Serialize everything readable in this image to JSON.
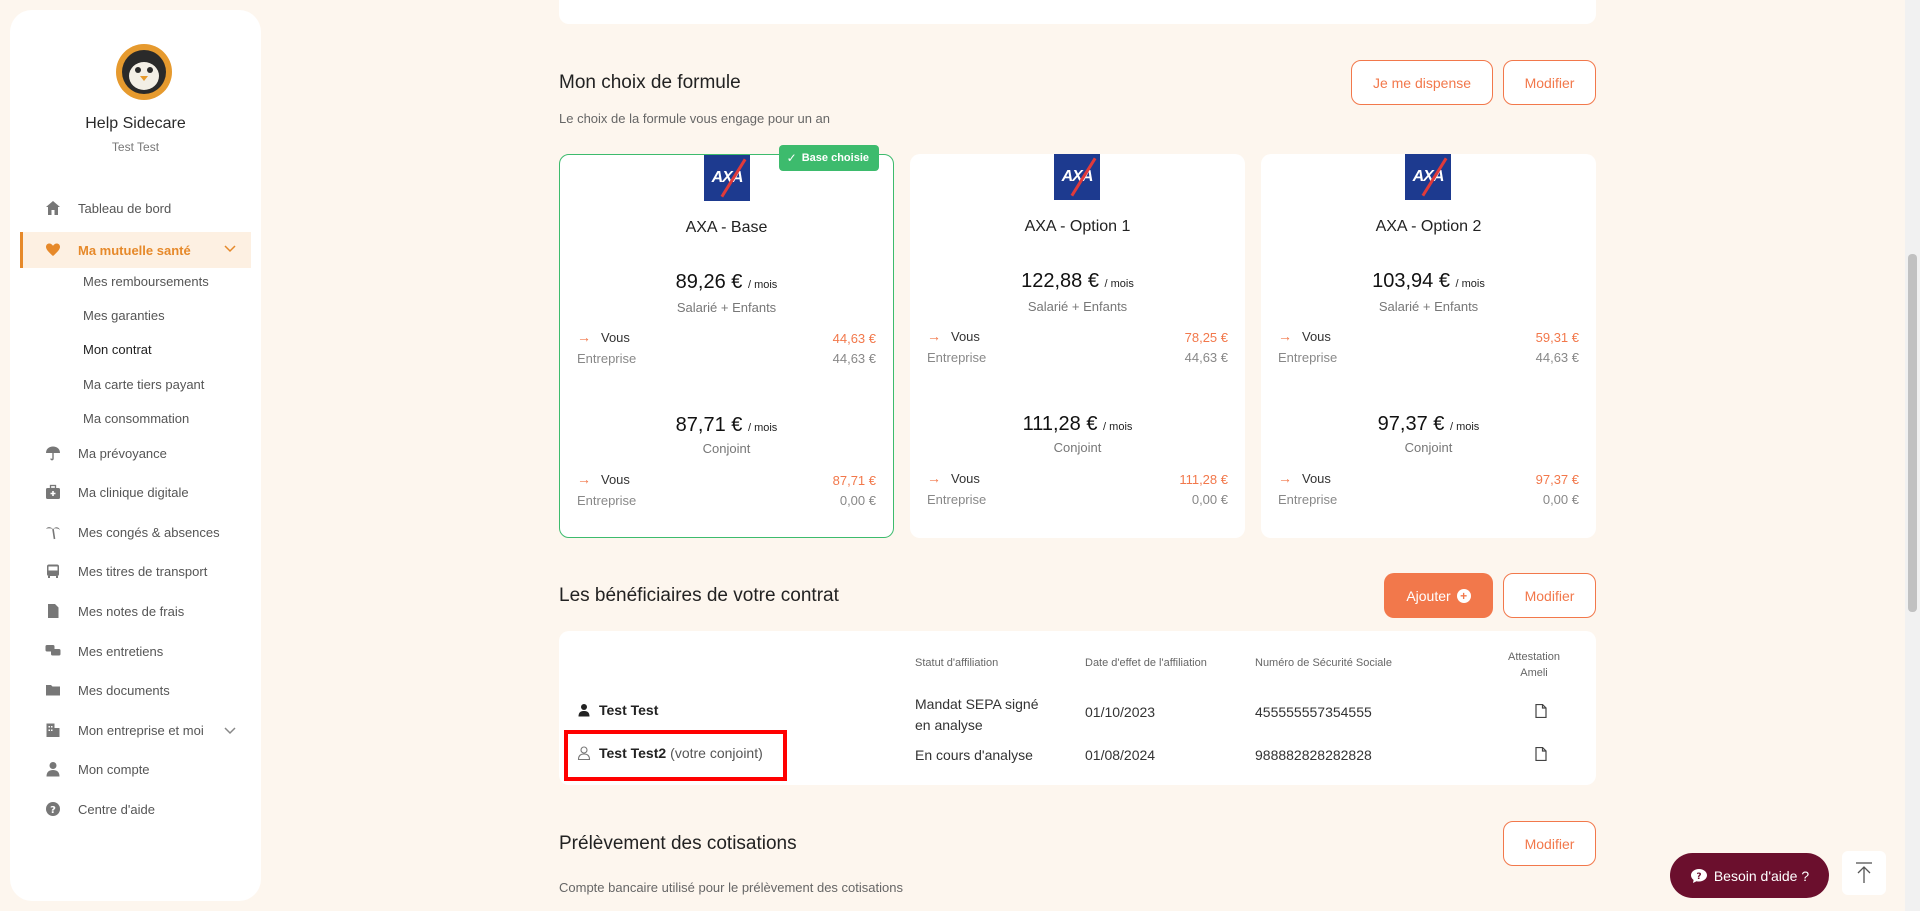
{
  "sidebar": {
    "user_name": "Help Sidecare",
    "user_sub": "Test Test",
    "items": [
      {
        "label": "Tableau de bord",
        "icon": "home-icon"
      },
      {
        "label": "Ma mutuelle santé",
        "icon": "heart-icon"
      },
      {
        "label": "Ma prévoyance",
        "icon": "umbrella-icon"
      },
      {
        "label": "Ma clinique digitale",
        "icon": "medical-bag-icon"
      },
      {
        "label": "Mes congés & absences",
        "icon": "palm-tree-icon"
      },
      {
        "label": "Mes titres de transport",
        "icon": "bus-icon"
      },
      {
        "label": "Mes notes de frais",
        "icon": "file-icon"
      },
      {
        "label": "Mes entretiens",
        "icon": "chat-icon"
      },
      {
        "label": "Mes documents",
        "icon": "folder-icon"
      },
      {
        "label": "Mon entreprise et moi",
        "icon": "building-icon"
      },
      {
        "label": "Mon compte",
        "icon": "user-icon"
      },
      {
        "label": "Centre d'aide",
        "icon": "help-circle-icon"
      }
    ],
    "sub_items": [
      "Mes remboursements",
      "Mes garanties",
      "Mon contrat",
      "Ma carte tiers payant",
      "Ma consommation"
    ]
  },
  "formule": {
    "title": "Mon choix de formule",
    "subtitle": "Le choix de la formule vous engage pour un an",
    "btn_dispense": "Je me dispense",
    "btn_modifier": "Modifier",
    "badge": "Base choisie",
    "logo_text": "AXA",
    "per_month": "/ mois",
    "plans": [
      {
        "name": "AXA - Base",
        "blocks": [
          {
            "price": "89,26 €",
            "who": "Salarié + Enfants",
            "vous_label": "Vous",
            "vous": "44,63 €",
            "ent_label": "Entreprise",
            "ent": "44,63 €"
          },
          {
            "price": "87,71 €",
            "who": "Conjoint",
            "vous_label": "Vous",
            "vous": "87,71 €",
            "ent_label": "Entreprise",
            "ent": "0,00 €"
          }
        ]
      },
      {
        "name": "AXA - Option 1",
        "blocks": [
          {
            "price": "122,88 €",
            "who": "Salarié + Enfants",
            "vous_label": "Vous",
            "vous": "78,25 €",
            "ent_label": "Entreprise",
            "ent": "44,63 €"
          },
          {
            "price": "111,28 €",
            "who": "Conjoint",
            "vous_label": "Vous",
            "vous": "111,28 €",
            "ent_label": "Entreprise",
            "ent": "0,00 €"
          }
        ]
      },
      {
        "name": "AXA - Option 2",
        "blocks": [
          {
            "price": "103,94 €",
            "who": "Salarié + Enfants",
            "vous_label": "Vous",
            "vous": "59,31 €",
            "ent_label": "Entreprise",
            "ent": "44,63 €"
          },
          {
            "price": "97,37 €",
            "who": "Conjoint",
            "vous_label": "Vous",
            "vous": "97,37 €",
            "ent_label": "Entreprise",
            "ent": "0,00 €"
          }
        ]
      }
    ]
  },
  "beneficiaires": {
    "title": "Les bénéficiaires de votre contrat",
    "btn_ajouter": "Ajouter",
    "btn_modifier": "Modifier",
    "headers": [
      "Statut d'affiliation",
      "Date d'effet de l'affiliation",
      "Numéro de Sécurité Sociale",
      "Attestation Ameli"
    ],
    "rows": [
      {
        "name": "Test Test",
        "relation": "",
        "statut": "Mandat SEPA signé en analyse",
        "date": "01/10/2023",
        "nss": "455555557354555"
      },
      {
        "name": "Test Test2",
        "relation": "(votre conjoint)",
        "statut": "En cours d'analyse",
        "date": "01/08/2024",
        "nss": "988882828282828"
      }
    ]
  },
  "prelevement": {
    "title": "Prélèvement des cotisations",
    "subtitle": "Compte bancaire utilisé pour le prélèvement des cotisations",
    "btn_modifier": "Modifier"
  },
  "help_button": "Besoin d'aide ?",
  "colors": {
    "accent": "#f2784b",
    "sidebar_active": "#e6892a",
    "chosen": "#3dbb6d",
    "help": "#6b0f2d"
  }
}
